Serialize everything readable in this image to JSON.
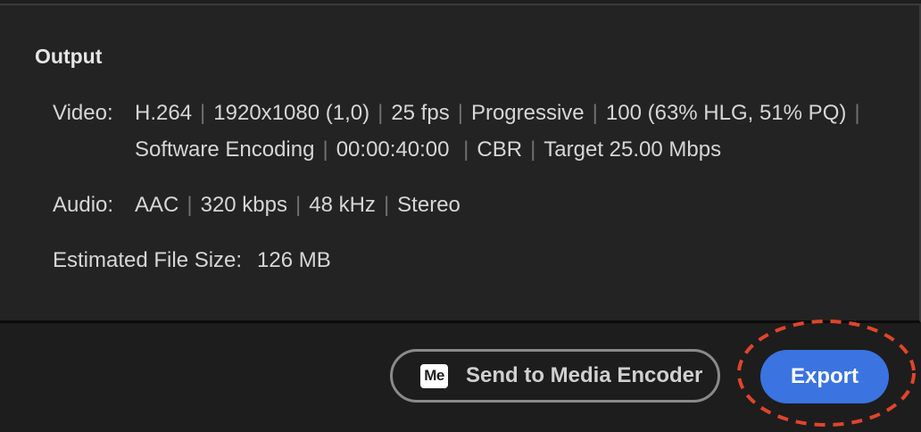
{
  "output": {
    "title": "Output",
    "video": {
      "label": "Video:",
      "line1": [
        "H.264",
        "1920x1080 (1,0)",
        "25 fps",
        "Progressive",
        "100 (63% HLG, 51% PQ)"
      ],
      "line2": [
        "Software Encoding",
        "00:00:40:00 ",
        "CBR",
        "Target 25.00 Mbps"
      ]
    },
    "audio": {
      "label": "Audio:",
      "values": [
        "AAC",
        "320 kbps",
        "48 kHz",
        "Stereo"
      ]
    },
    "file_size": {
      "label": "Estimated File Size:",
      "value": "126 MB"
    }
  },
  "actions": {
    "media_encoder_icon_text": "Me",
    "media_encoder_icon": "media-encoder-icon",
    "send_to_media_encoder_label": "Send to Media Encoder",
    "export_label": "Export"
  },
  "colors": {
    "export_button": "#3b73e0",
    "highlight_ring": "#e0442c",
    "panel_background": "#232323"
  }
}
